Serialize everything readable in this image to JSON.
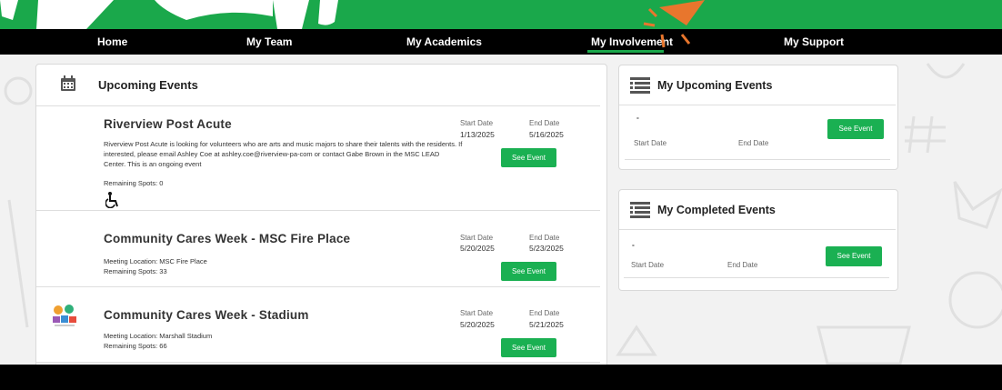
{
  "nav": {
    "items": [
      {
        "label": "Home"
      },
      {
        "label": "My Team"
      },
      {
        "label": "My Academics"
      },
      {
        "label": "My Involvement"
      },
      {
        "label": "My Support"
      }
    ],
    "active": "My Involvement"
  },
  "upcoming": {
    "title": "Upcoming Events",
    "events": [
      {
        "title": "Riverview Post Acute",
        "description": "Riverview Post Acute is looking for volunteers who are arts and music majors to share their talents with the residents. If interested, please email Ashley Coe at ashley.coe@riverview-pa-com or contact Gabe Brown in the MSC LEAD Center. This is an ongoing event",
        "remaining": "Remaining Spots: 0",
        "start_label": "Start Date",
        "start": "1/13/2025",
        "end_label": "End Date",
        "end": "5/16/2025",
        "button": "See Event"
      },
      {
        "title": "Community Cares Week - MSC Fire Place",
        "location": "Meeting Location: MSC Fire Place",
        "remaining": "Remaining Spots: 33",
        "start_label": "Start Date",
        "start": "5/20/2025",
        "end_label": "End Date",
        "end": "5/23/2025",
        "button": "See Event"
      },
      {
        "title": "Community Cares Week - Stadium",
        "location": "Meeting Location: Marshall Stadium",
        "remaining": "Remaining Spots: 66",
        "start_label": "Start Date",
        "start": "5/20/2025",
        "end_label": "End Date",
        "end": "5/21/2025",
        "button": "See Event"
      }
    ]
  },
  "my_upcoming": {
    "title": "My Upcoming Events",
    "dash": "-",
    "start_label": "Start Date",
    "end_label": "End Date",
    "button": "See Event"
  },
  "my_completed": {
    "title": "My Completed Events",
    "dash": "-",
    "start_label": "Start Date",
    "end_label": "End Date",
    "button": "See Event"
  },
  "colors": {
    "brand_green": "#1aa84b",
    "button_green": "#1ab052",
    "accent_orange": "#e8762d",
    "nav_black": "#000000"
  },
  "icons": {
    "calendar": "calendar-icon",
    "list": "list-icon",
    "wheelchair": "wheelchair-icon"
  }
}
